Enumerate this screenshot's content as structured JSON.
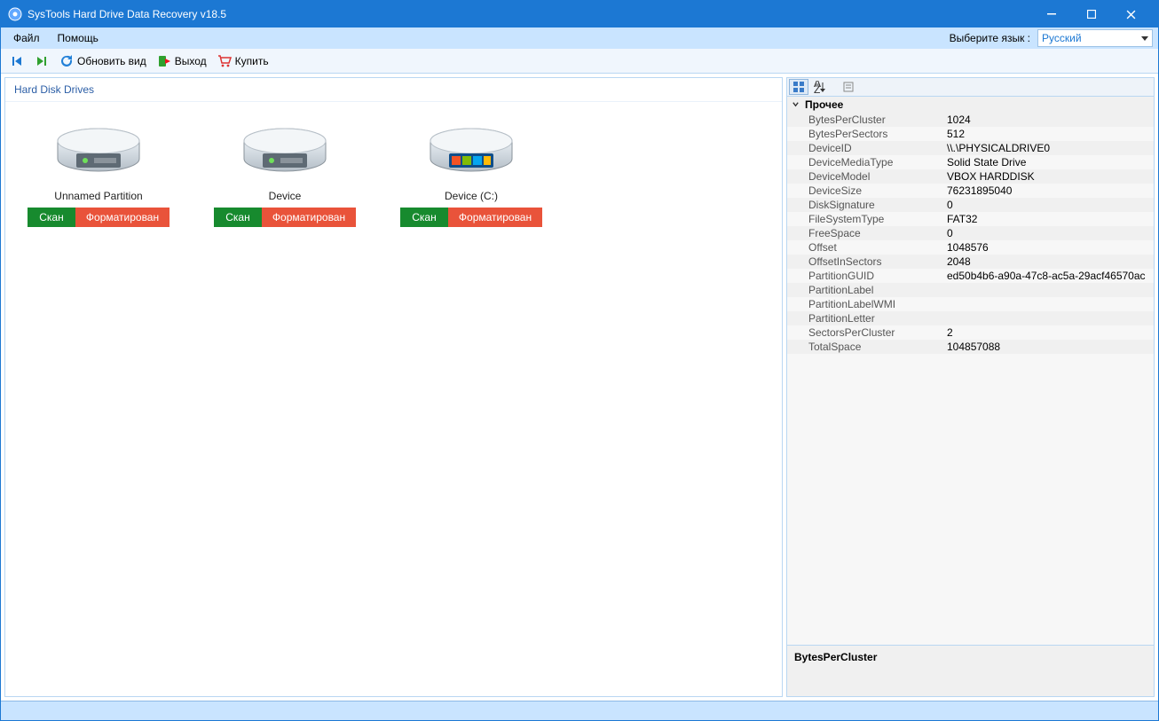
{
  "title": "SysTools Hard Drive Data Recovery v18.5",
  "menu": {
    "file": "Файл",
    "help": "Помощь"
  },
  "lang": {
    "label": "Выберите язык :",
    "value": "Русский"
  },
  "toolbar": {
    "refresh": "Обновить вид",
    "exit": "Выход",
    "buy": "Купить"
  },
  "left_header": "Hard Disk Drives",
  "drives": [
    {
      "label": "Unnamed Partition",
      "scan": "Скан",
      "fmt": "Форматирован",
      "os": false
    },
    {
      "label": "Device",
      "scan": "Скан",
      "fmt": "Форматирован",
      "os": false
    },
    {
      "label": "Device (C:)",
      "scan": "Скан",
      "fmt": "Форматирован",
      "os": true
    }
  ],
  "props_section": "Прочее",
  "props": [
    {
      "k": "BytesPerCluster",
      "v": "1024"
    },
    {
      "k": "BytesPerSectors",
      "v": "512"
    },
    {
      "k": "DeviceID",
      "v": "\\\\.\\PHYSICALDRIVE0"
    },
    {
      "k": "DeviceMediaType",
      "v": "Solid State Drive"
    },
    {
      "k": "DeviceModel",
      "v": "VBOX HARDDISK"
    },
    {
      "k": "DeviceSize",
      "v": "76231895040"
    },
    {
      "k": "DiskSignature",
      "v": "0"
    },
    {
      "k": "FileSystemType",
      "v": "FAT32"
    },
    {
      "k": "FreeSpace",
      "v": "0"
    },
    {
      "k": "Offset",
      "v": "1048576"
    },
    {
      "k": "OffsetInSectors",
      "v": "2048"
    },
    {
      "k": "PartitionGUID",
      "v": "ed50b4b6-a90a-47c8-ac5a-29acf46570ac"
    },
    {
      "k": "PartitionLabel",
      "v": ""
    },
    {
      "k": "PartitionLabelWMI",
      "v": ""
    },
    {
      "k": "PartitionLetter",
      "v": ""
    },
    {
      "k": "SectorsPerCluster",
      "v": "2"
    },
    {
      "k": "TotalSpace",
      "v": "104857088"
    }
  ],
  "prop_desc": "BytesPerCluster"
}
